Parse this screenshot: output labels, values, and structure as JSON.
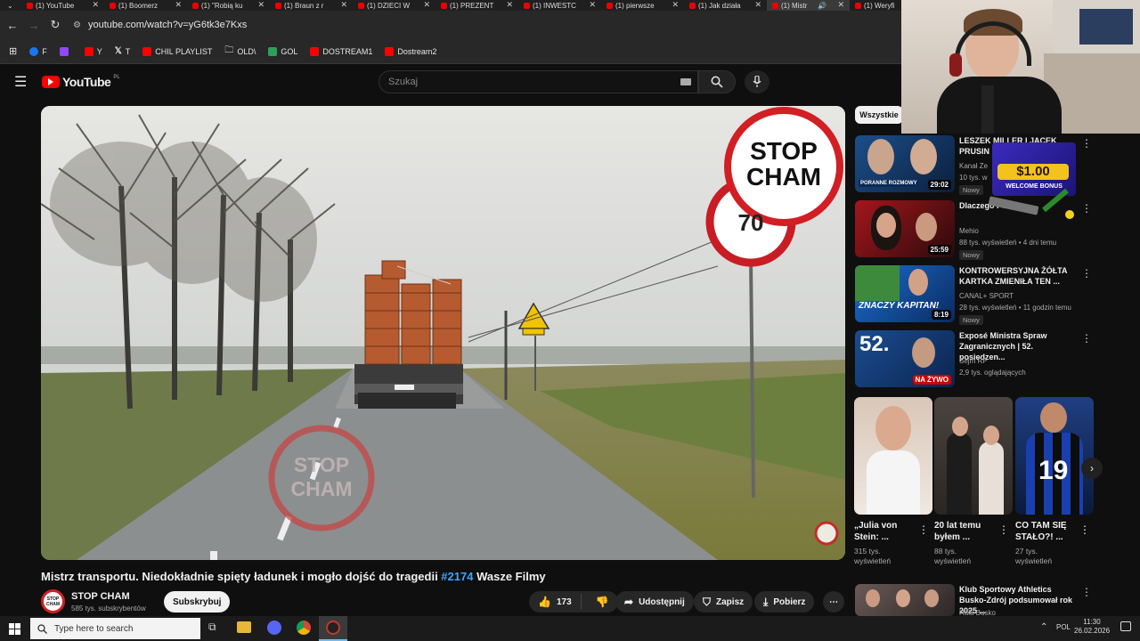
{
  "browser": {
    "tabs": [
      {
        "label": "(1) YouTube"
      },
      {
        "label": "(1) Boomerz"
      },
      {
        "label": "(1) \"Robią ku"
      },
      {
        "label": "(1) Braun z r"
      },
      {
        "label": "(1) DZIECI W"
      },
      {
        "label": "(1) PREZENT"
      },
      {
        "label": "(1) INWESTC"
      },
      {
        "label": "(1) pierwsze"
      },
      {
        "label": "(1) Jak działa"
      },
      {
        "label": "(1) Mistr"
      },
      {
        "label": "(1) Weryfi"
      }
    ],
    "url": "youtube.com/watch?v=yG6tk3e7Kxs",
    "bookmarks": [
      {
        "label": "F",
        "color": "#1877f2"
      },
      {
        "label": "",
        "color": "#9146ff"
      },
      {
        "label": "Y",
        "color": "#ff0000"
      },
      {
        "label": "T",
        "color": "#ffffff"
      },
      {
        "label": "CHIL PLAYLIST",
        "color": "#ff0000"
      },
      {
        "label": "OLD\\",
        "color": "#cccccc"
      },
      {
        "label": "GOL",
        "color": "#2aa15a"
      },
      {
        "label": "DOSTREAM1",
        "color": "#ff0000"
      },
      {
        "label": "Dostream2",
        "color": "#ff0000"
      }
    ]
  },
  "youtube": {
    "logo": "YouTube",
    "logo_region": "PL",
    "search_placeholder": "Szukaj",
    "video_title_main": "Mistrz transportu. Niedokładnie spięty ładunek i mogło dojść do tragedii ",
    "video_title_tag": "#2174",
    "video_title_tail": " Wasze Filmy",
    "overlay_stop": "STOP",
    "overlay_cham": "CHAM",
    "speed_sign": "70",
    "channel": {
      "name": "STOP CHAM",
      "subs": "585 tys. subskrybentów",
      "subscribe": "Subskrybuj"
    },
    "actions": {
      "likes": "173",
      "share": "Udostępnij",
      "save": "Zapisz",
      "download": "Pobierz"
    },
    "chip_all": "Wszystkie",
    "recommendations": [
      {
        "title": "LESZEK MILLER I JACEK PRUSIN",
        "channel": "Kanał Ze",
        "meta": "10 tys. w",
        "badge": "Nowy",
        "duration": "29:02",
        "thumb_text": "PORANNE ROZMOWY"
      },
      {
        "title": "Dlaczego Potwor",
        "channel": "Mehio",
        "meta": "88 tys. wyświetleń • 4 dni temu",
        "badge": "Nowy",
        "duration": "25:59",
        "thumb_text": ""
      },
      {
        "title": "KONTROWERSYJNA ŻÓŁTA KARTKA ZMIENIŁA TEN ...",
        "channel": "CANAL+ SPORT",
        "meta": "28 tys. wyświetleń • 11 godzin temu",
        "badge": "Nowy",
        "duration": "8:19",
        "thumb_text": "ZNACZY KAPITAN!"
      },
      {
        "title": "Exposé Ministra Spraw Zagranicznych | 52. posiedzen...",
        "channel": "Sejm RP",
        "meta": "2,9 tys. oglądających",
        "badge": "",
        "duration": "NA ŻYWO",
        "thumb_text": "52."
      }
    ],
    "shorts": [
      {
        "title": "„Julia von Stein: ...",
        "views": "315 tys. wyświetleń"
      },
      {
        "title": "20 lat temu byłem ...",
        "views": "88 tys. wyświetleń"
      },
      {
        "title": "CO TAM SIĘ STAŁO?! ...",
        "views": "27 tys. wyświetleń"
      }
    ],
    "last_rec": {
      "title": "Klub Sportowy Athletics Busko-Zdrój podsumował rok 2025 ...",
      "channel": "Hala Busko"
    },
    "ad": {
      "amount": "$1.00",
      "caption": "WELCOME BONUS"
    }
  },
  "taskbar": {
    "search": "Type here to search",
    "lang": "POL",
    "time": "11:30",
    "date": "26.02.2026"
  }
}
